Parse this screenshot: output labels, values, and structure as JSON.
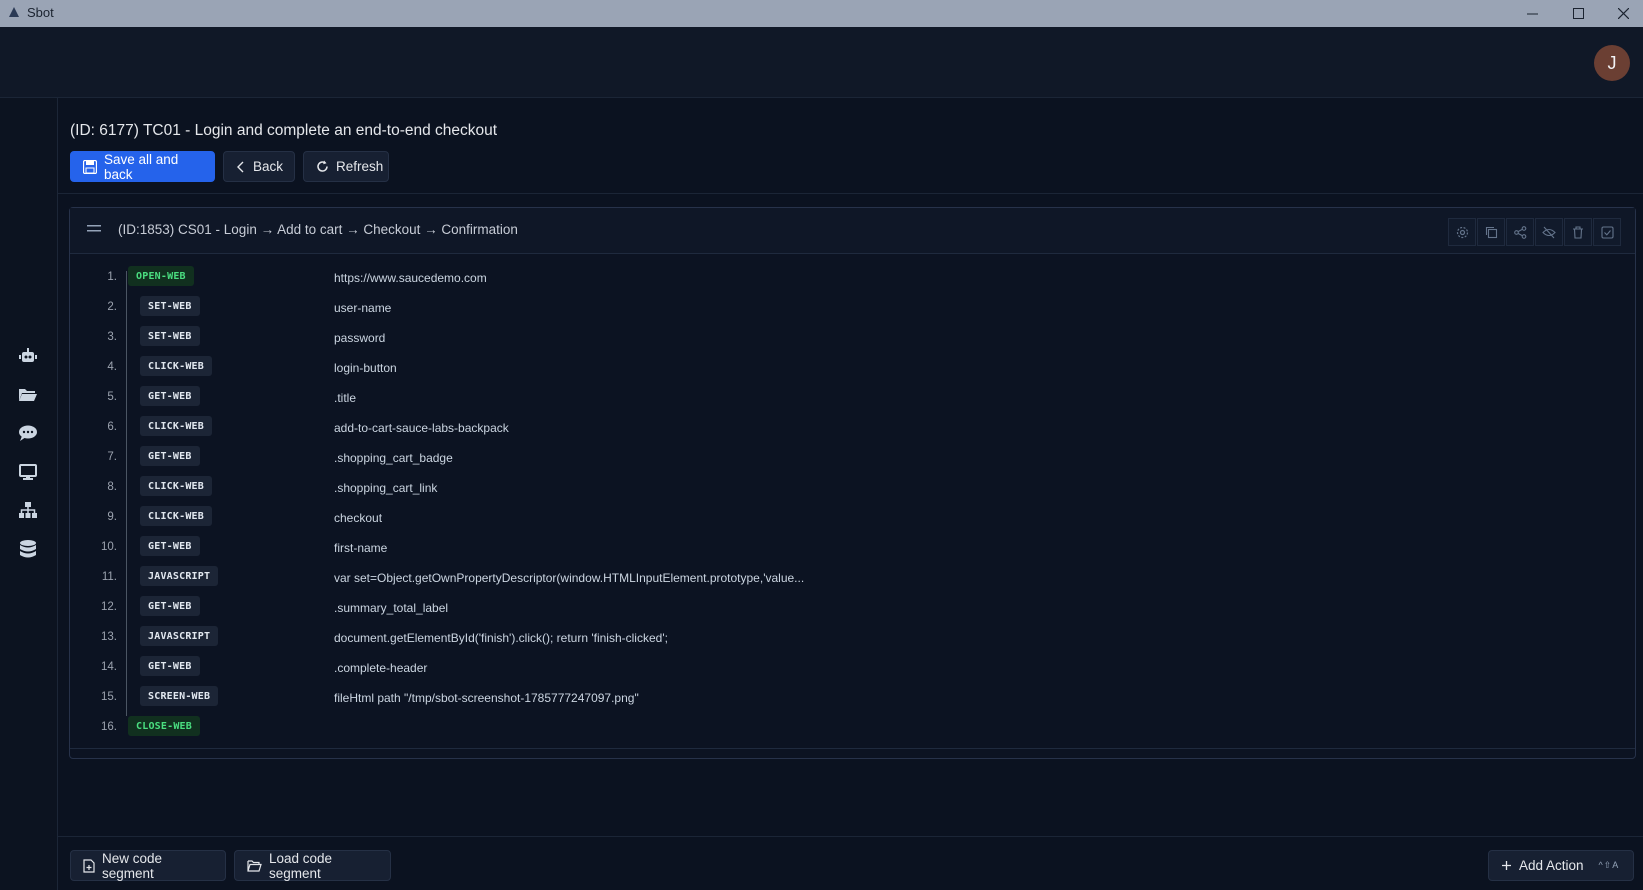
{
  "window": {
    "title": "Sbot",
    "icons": [
      "app-icon",
      "minimize-icon",
      "maximize-icon",
      "close-icon"
    ]
  },
  "user": {
    "avatar_initial": "J"
  },
  "sidebar": {
    "icons": [
      "robot-icon",
      "folder-icon",
      "chat-icon",
      "monitor-icon",
      "sitemap-icon",
      "database-icon"
    ]
  },
  "page": {
    "title": "(ID: 6177) TC01 - Login and complete an end-to-end checkout",
    "save_label": "Save all and back",
    "back_label": "Back",
    "refresh_label": "Refresh"
  },
  "segment": {
    "title": "(ID:1853) CS01 - Login → Add to cart → Checkout → Confirmation",
    "tool_icons": [
      "settings-icon",
      "copy-icon",
      "share-icon",
      "hide-icon",
      "trash-icon",
      "check-square-icon"
    ],
    "steps": [
      {
        "num": "1.",
        "action": "OPEN-WEB",
        "value": "https://www.saucedemo.com"
      },
      {
        "num": "2.",
        "action": "SET-WEB",
        "value": "user-name"
      },
      {
        "num": "3.",
        "action": "SET-WEB",
        "value": "password"
      },
      {
        "num": "4.",
        "action": "CLICK-WEB",
        "value": "login-button"
      },
      {
        "num": "5.",
        "action": "GET-WEB",
        "value": ".title"
      },
      {
        "num": "6.",
        "action": "CLICK-WEB",
        "value": "add-to-cart-sauce-labs-backpack"
      },
      {
        "num": "7.",
        "action": "GET-WEB",
        "value": ".shopping_cart_badge"
      },
      {
        "num": "8.",
        "action": "CLICK-WEB",
        "value": ".shopping_cart_link"
      },
      {
        "num": "9.",
        "action": "CLICK-WEB",
        "value": "checkout"
      },
      {
        "num": "10.",
        "action": "GET-WEB",
        "value": "first-name"
      },
      {
        "num": "11.",
        "action": "JAVASCRIPT",
        "value": "var set=Object.getOwnPropertyDescriptor(window.HTMLInputElement.prototype,'value..."
      },
      {
        "num": "12.",
        "action": "GET-WEB",
        "value": ".summary_total_label"
      },
      {
        "num": "13.",
        "action": "JAVASCRIPT",
        "value": "document.getElementById('finish').click(); return 'finish-clicked';"
      },
      {
        "num": "14.",
        "action": "GET-WEB",
        "value": ".complete-header"
      },
      {
        "num": "15.",
        "action": "SCREEN-WEB",
        "value": "fileHtml path \"/tmp/sbot-screenshot-1785777247097.png\""
      },
      {
        "num": "16.",
        "action": "CLOSE-WEB",
        "value": ""
      }
    ]
  },
  "footer": {
    "new_segment_label": "New code segment",
    "load_segment_label": "Load code segment",
    "add_action_label": "Add Action",
    "add_action_shortcut": "^⇧A"
  },
  "colors": {
    "background": "#0b1220",
    "primary": "#2563eb",
    "open_close_badge": "#4ade80"
  }
}
